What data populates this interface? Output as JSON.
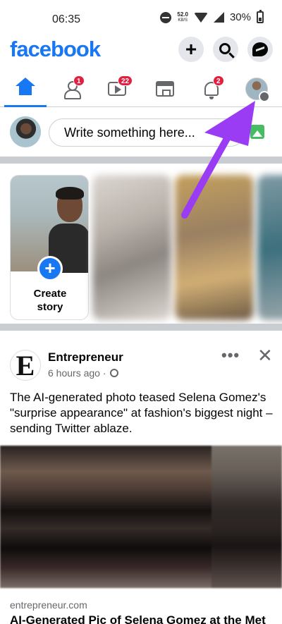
{
  "status_bar": {
    "time": "06:35",
    "net_speed": "52.0",
    "net_unit": "KB/S",
    "battery": "30%"
  },
  "header": {
    "logo": "facebook",
    "plus_label": "+",
    "icons": [
      "plus-icon",
      "search-icon",
      "messenger-icon"
    ]
  },
  "nav": {
    "tabs": [
      {
        "name": "home",
        "badge": ""
      },
      {
        "name": "friends",
        "badge": "1"
      },
      {
        "name": "video",
        "badge": "22"
      },
      {
        "name": "marketplace",
        "badge": ""
      },
      {
        "name": "notifications",
        "badge": "2"
      },
      {
        "name": "menu-profile",
        "badge": ""
      }
    ]
  },
  "composer": {
    "placeholder": "Write something here..."
  },
  "stories": {
    "create_label": "Create story",
    "create_plus": "+"
  },
  "post": {
    "author": "Entrepreneur",
    "avatar_letter": "E",
    "time": "6 hours ago",
    "more": "•••",
    "close": "✕",
    "text": "The AI-generated photo teased Selena Gomez's \"surprise appearance\" at fashion's biggest night – sending Twitter ablaze.",
    "link_domain": "entrepreneur.com",
    "link_title": "AI-Generated Pic of Selena Gomez at the Met"
  },
  "colors": {
    "brand": "#1877f2",
    "badge": "#e41e3f",
    "annotation_arrow": "#9b3cf5"
  }
}
